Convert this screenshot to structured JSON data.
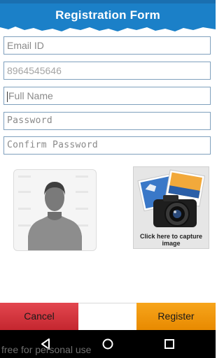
{
  "header": {
    "title": "Registration Form"
  },
  "form": {
    "email": {
      "placeholder": "Email ID"
    },
    "phone": {
      "value": "8964545646"
    },
    "full_name": {
      "placeholder": "Full Name"
    },
    "password": {
      "placeholder": "Password"
    },
    "confirm_password": {
      "placeholder": "Confirm Password"
    }
  },
  "photo": {
    "avatar_icon": "person-silhouette-icon",
    "camera_caption_line1": "Click here to capture",
    "camera_caption_line2": "image"
  },
  "actions": {
    "cancel_label": "Cancel",
    "register_label": "Register"
  },
  "navbar": {
    "icons": [
      "back-icon",
      "home-icon",
      "recents-icon"
    ]
  },
  "watermark": "free for personal use",
  "colors": {
    "header": "#1b80c8",
    "cancel": "#d6343c",
    "register": "#f29a10",
    "field_border": "#7fa0bd"
  }
}
